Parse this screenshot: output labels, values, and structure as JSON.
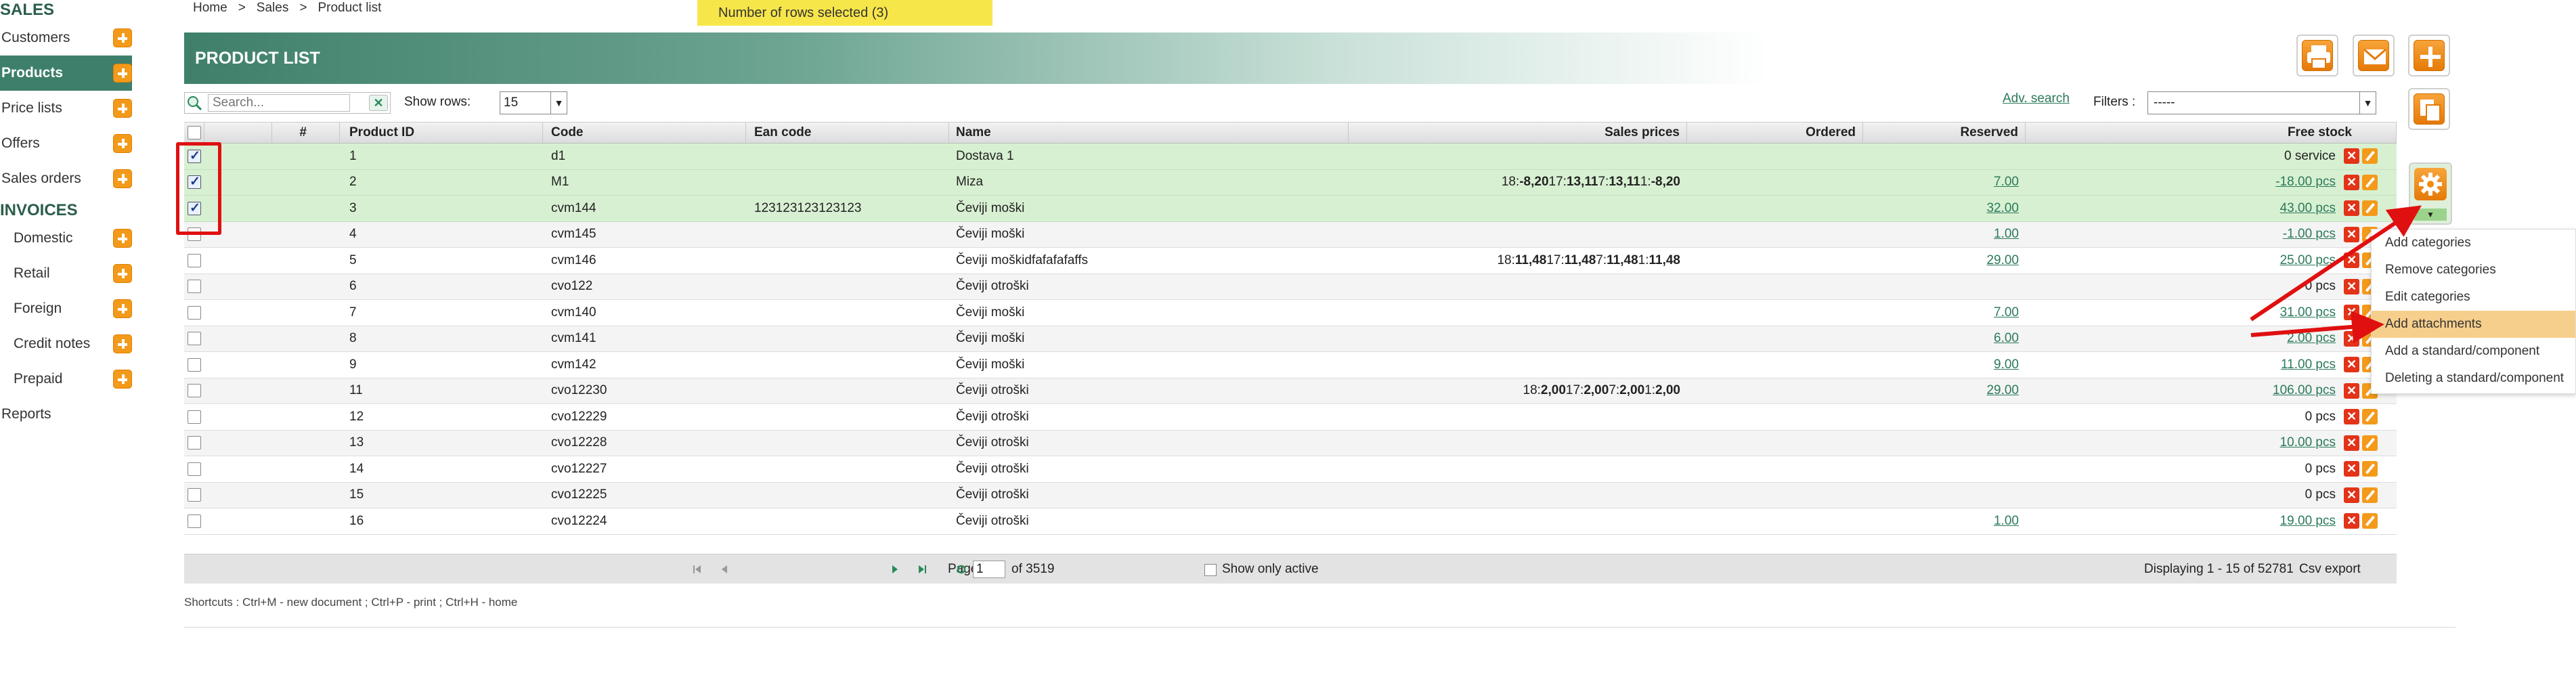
{
  "sidebar": {
    "sales_title": "SALES",
    "sales_items": [
      {
        "label": "Customers",
        "plus": true
      },
      {
        "label": "Products",
        "plus": true,
        "active": true
      },
      {
        "label": "Price lists",
        "plus": true
      },
      {
        "label": "Offers",
        "plus": true
      },
      {
        "label": "Sales orders",
        "plus": true
      }
    ],
    "invoices_title": "INVOICES",
    "invoice_items": [
      {
        "label": "Domestic",
        "plus": true
      },
      {
        "label": "Retail",
        "plus": true
      },
      {
        "label": "Foreign",
        "plus": true
      },
      {
        "label": "Credit notes",
        "plus": true
      },
      {
        "label": "Prepaid",
        "plus": true
      }
    ],
    "reports_label": "Reports"
  },
  "breadcrumb": {
    "home": "Home",
    "sep": ">",
    "sales": "Sales",
    "current": "Product list"
  },
  "selection_badge": "Number of rows selected (3)",
  "page_title": "PRODUCT LIST",
  "toolbar": {
    "search_placeholder": "Search...",
    "clear_icon": "✕",
    "show_rows_label": "Show rows:",
    "show_rows_value": "15",
    "adv_search": "Adv. search",
    "filters_label": "Filters :",
    "filters_value": "-----"
  },
  "table": {
    "headers": {
      "hash": "#",
      "product_id": "Product ID",
      "code": "Code",
      "ean": "Ean code",
      "name": "Name",
      "sales_prices": "Sales prices",
      "ordered": "Ordered",
      "reserved": "Reserved",
      "free_stock": "Free stock"
    },
    "rows": [
      {
        "checked": true,
        "id": "1",
        "code": "d1",
        "ean": "",
        "name": "Dostava 1",
        "prices": [],
        "ordered": "",
        "reserved": "",
        "stock": "0 service",
        "stock_link": false
      },
      {
        "checked": true,
        "id": "2",
        "code": "M1",
        "ean": "",
        "name": "Miza",
        "prices": [
          [
            "18:",
            "-8,20"
          ],
          [
            "17:",
            "13,11"
          ],
          [
            "7:",
            "13,11"
          ],
          [
            "1:",
            "-8,20"
          ]
        ],
        "ordered": "",
        "reserved": "7.00",
        "stock": "-18.00 pcs",
        "stock_link": true
      },
      {
        "checked": true,
        "id": "3",
        "code": "cvm144",
        "ean": "123123123123123",
        "name": "Čeviji moški",
        "prices": [],
        "ordered": "",
        "reserved": "32.00",
        "stock": "43.00 pcs",
        "stock_link": true
      },
      {
        "checked": false,
        "id": "4",
        "code": "cvm145",
        "ean": "",
        "name": "Čeviji moški",
        "prices": [],
        "ordered": "",
        "reserved": "1.00",
        "stock": "-1.00 pcs",
        "stock_link": true
      },
      {
        "checked": false,
        "id": "5",
        "code": "cvm146",
        "ean": "",
        "name": "Čeviji moškidfafafafaffs",
        "prices": [
          [
            "18:",
            "11,48"
          ],
          [
            "17:",
            "11,48"
          ],
          [
            "7:",
            "11,48"
          ],
          [
            "1:",
            "11,48"
          ]
        ],
        "ordered": "",
        "reserved": "29.00",
        "stock": "25.00 pcs",
        "stock_link": true
      },
      {
        "checked": false,
        "id": "6",
        "code": "cvo122",
        "ean": "",
        "name": "Čeviji otroški",
        "prices": [],
        "ordered": "",
        "reserved": "",
        "stock": "0 pcs",
        "stock_link": false
      },
      {
        "checked": false,
        "id": "7",
        "code": "cvm140",
        "ean": "",
        "name": "Čeviji moški",
        "prices": [],
        "ordered": "",
        "reserved": "7.00",
        "stock": "31.00 pcs",
        "stock_link": true
      },
      {
        "checked": false,
        "id": "8",
        "code": "cvm141",
        "ean": "",
        "name": "Čeviji moški",
        "prices": [],
        "ordered": "",
        "reserved": "6.00",
        "stock": "2.00 pcs",
        "stock_link": true
      },
      {
        "checked": false,
        "id": "9",
        "code": "cvm142",
        "ean": "",
        "name": "Čeviji moški",
        "prices": [],
        "ordered": "",
        "reserved": "9.00",
        "stock": "11.00 pcs",
        "stock_link": true
      },
      {
        "checked": false,
        "id": "11",
        "code": "cvo12230",
        "ean": "",
        "name": "Čeviji otroški",
        "prices": [
          [
            "18:",
            "2,00"
          ],
          [
            "17:",
            "2,00"
          ],
          [
            "7:",
            "2,00"
          ],
          [
            "1:",
            "2,00"
          ]
        ],
        "ordered": "",
        "reserved": "29.00",
        "stock": "106.00 pcs",
        "stock_link": true
      },
      {
        "checked": false,
        "id": "12",
        "code": "cvo12229",
        "ean": "",
        "name": "Čeviji otroški",
        "prices": [],
        "ordered": "",
        "reserved": "",
        "stock": "0 pcs",
        "stock_link": false
      },
      {
        "checked": false,
        "id": "13",
        "code": "cvo12228",
        "ean": "",
        "name": "Čeviji otroški",
        "prices": [],
        "ordered": "",
        "reserved": "",
        "stock": "10.00 pcs",
        "stock_link": true
      },
      {
        "checked": false,
        "id": "14",
        "code": "cvo12227",
        "ean": "",
        "name": "Čeviji otroški",
        "prices": [],
        "ordered": "",
        "reserved": "",
        "stock": "0 pcs",
        "stock_link": false
      },
      {
        "checked": false,
        "id": "15",
        "code": "cvo12225",
        "ean": "",
        "name": "Čeviji otroški",
        "prices": [],
        "ordered": "",
        "reserved": "",
        "stock": "0 pcs",
        "stock_link": false
      },
      {
        "checked": false,
        "id": "16",
        "code": "cvo12224",
        "ean": "",
        "name": "Čeviji otroški",
        "prices": [],
        "ordered": "",
        "reserved": "1.00",
        "stock": "19.00 pcs",
        "stock_link": true
      }
    ]
  },
  "pager": {
    "page_label": "Page",
    "page_value": "1",
    "of_label": "of 3519",
    "show_active": "Show only active",
    "displaying": "Displaying 1 - 15 of 52781",
    "csv_export": "Csv export"
  },
  "shortcuts": "Shortcuts : Ctrl+M - new document ;   Ctrl+P - print ;   Ctrl+H - home",
  "actions_menu": {
    "items": [
      {
        "label": "Add categories"
      },
      {
        "label": "Remove categories"
      },
      {
        "label": "Edit categories"
      },
      {
        "label": "Add attachments",
        "highlight": true
      },
      {
        "label": "Add a standard/component"
      },
      {
        "label": "Deleting a standard/component"
      }
    ]
  },
  "icons": {
    "print": "printer-icon",
    "mail": "envelope-icon",
    "add": "plus-icon",
    "copy": "copy-icon",
    "gear": "gear-icon",
    "delete": "delete-icon",
    "edit": "pencil-icon"
  },
  "colors": {
    "brand_green": "#3d7f6a",
    "accent_orange": "#f39a1a",
    "selected_row": "#d8f0d2",
    "badge_yellow": "#f7e64a",
    "delete_red": "#e33318",
    "annotation_red": "#e01010"
  }
}
